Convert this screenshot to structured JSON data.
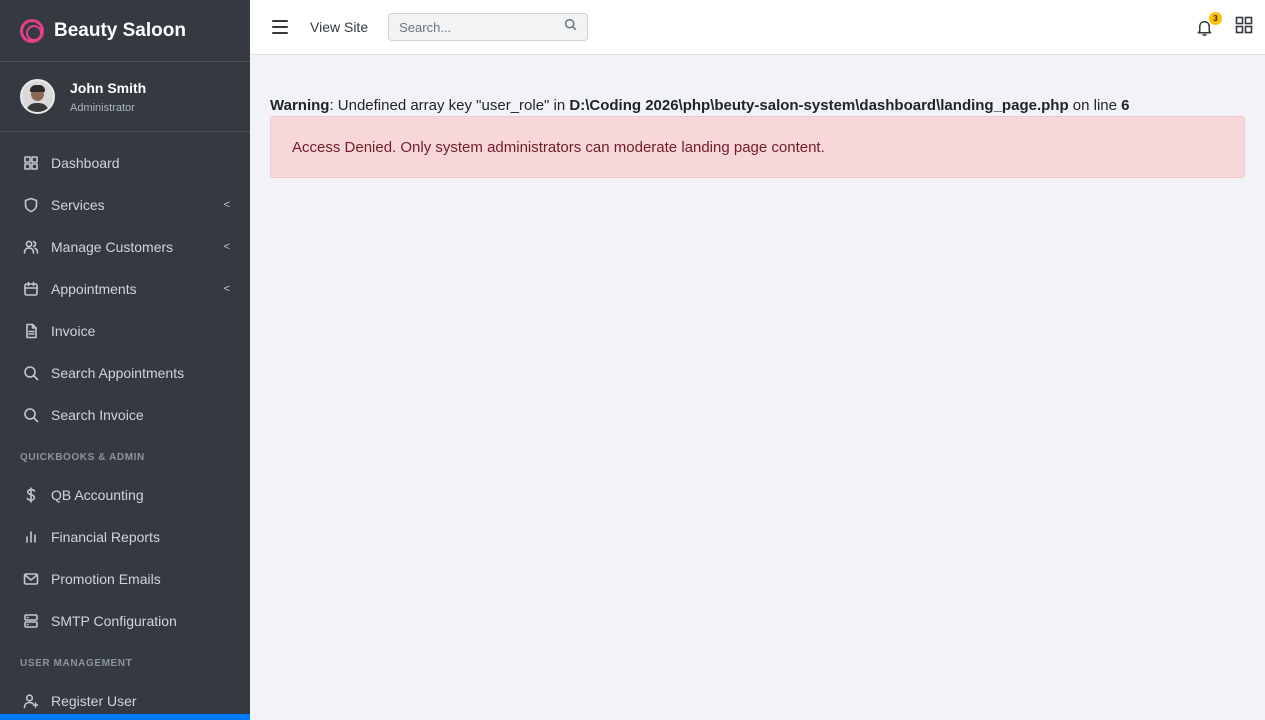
{
  "brand": {
    "name": "Beauty Saloon",
    "accent": "#e83e8c"
  },
  "user": {
    "name": "John Smith",
    "role": "Administrator"
  },
  "nav": {
    "items": [
      {
        "label": "Dashboard",
        "icon": "dashboard-icon"
      },
      {
        "label": "Services",
        "icon": "shield-icon",
        "caret": "<"
      },
      {
        "label": "Manage Customers",
        "icon": "users-icon",
        "caret": "<"
      },
      {
        "label": "Appointments",
        "icon": "calendar-icon",
        "caret": "<"
      },
      {
        "label": "Invoice",
        "icon": "file-icon"
      },
      {
        "label": "Search Appointments",
        "icon": "search-icon"
      },
      {
        "label": "Search Invoice",
        "icon": "search-icon"
      }
    ],
    "section_qb": "QUICKBOOKS & ADMIN",
    "qb_items": [
      {
        "label": "QB Accounting",
        "icon": "dollar-icon"
      },
      {
        "label": "Financial Reports",
        "icon": "bar-chart-icon"
      },
      {
        "label": "Promotion Emails",
        "icon": "mail-icon"
      },
      {
        "label": "SMTP Configuration",
        "icon": "server-icon"
      }
    ],
    "section_user": "USER MANAGEMENT",
    "user_items": [
      {
        "label": "Register User",
        "icon": "user-add-icon"
      }
    ]
  },
  "topbar": {
    "view_site": "View Site",
    "search_placeholder": "Search...",
    "notification_count": "3"
  },
  "warning": {
    "label": "Warning",
    "text1": ": Undefined array key \"user_role\" in ",
    "path": "D:\\Coding 2026\\php\\beuty-salon-system\\dashboard\\landing_page.php",
    "text2": " on line ",
    "line": "6"
  },
  "alert": {
    "message": "Access Denied. Only system administrators can moderate landing page content.",
    "color": "#f8d7da"
  }
}
